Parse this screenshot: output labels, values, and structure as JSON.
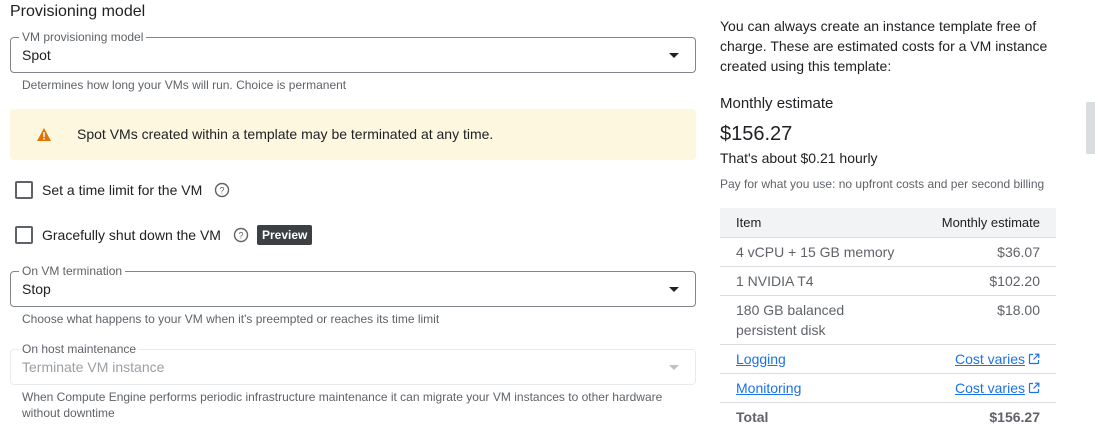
{
  "section": {
    "title": "Provisioning model"
  },
  "provisioning_field": {
    "legend": "VM provisioning model",
    "value": "Spot",
    "helper": "Determines how long your VMs will run. Choice is permanent"
  },
  "warning": {
    "icon": "warning-icon",
    "color": "#e37400",
    "text": "Spot VMs created within a template may be terminated at any time."
  },
  "time_limit": {
    "label": "Set a time limit for the VM"
  },
  "graceful": {
    "label": "Gracefully shut down the VM",
    "badge": "Preview"
  },
  "termination_field": {
    "legend": "On VM termination",
    "value": "Stop",
    "helper": "Choose what happens to your VM when it's preempted or reaches its time limit"
  },
  "maintenance_field": {
    "legend": "On host maintenance",
    "value": "Terminate VM instance",
    "helper": "When Compute Engine performs periodic infrastructure maintenance it can migrate your VM instances to other hardware without downtime"
  },
  "side": {
    "intro": "You can always create an instance template free of charge. These are estimated costs for a VM instance created using this template:",
    "estimate_title": "Monthly estimate",
    "price": "$156.27",
    "hourly": "That's about $0.21 hourly",
    "billing": "Pay for what you use: no upfront costs and per second billing"
  },
  "cost_table": {
    "header": {
      "item": "Item",
      "estimate": "Monthly estimate"
    },
    "rows": [
      {
        "item": "4 vCPU + 15 GB memory",
        "estimate": "$36.07"
      },
      {
        "item": "1 NVIDIA T4",
        "estimate": "$102.20"
      },
      {
        "item": "180 GB balanced persistent disk",
        "estimate": "$18.00"
      },
      {
        "item": "Logging",
        "estimate": "Cost varies"
      },
      {
        "item": "Monitoring",
        "estimate": "Cost varies"
      }
    ],
    "total": {
      "item": "Total",
      "estimate": "$156.27"
    }
  },
  "colors": {
    "link": "#1a73e8",
    "warning_bg": "#fef7e0",
    "badge_bg": "#3c4043"
  }
}
